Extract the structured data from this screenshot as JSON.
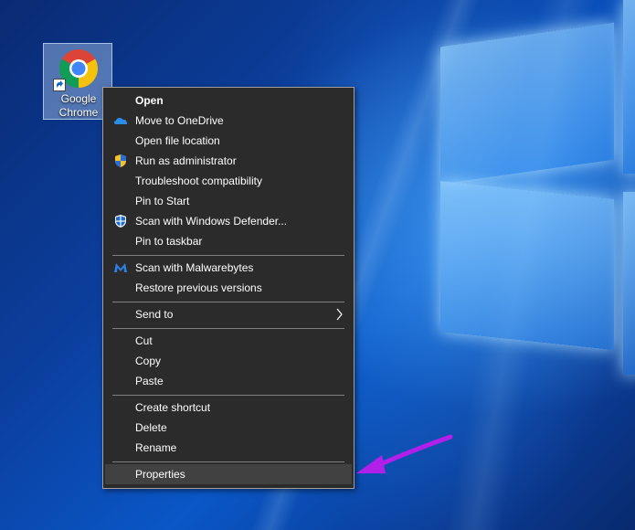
{
  "desktop": {
    "icon": {
      "name": "Google Chrome",
      "line1": "Google",
      "line2": "Chrome",
      "selected": true
    }
  },
  "context_menu": {
    "items": [
      {
        "label": "Open",
        "bold": true,
        "icon": null
      },
      {
        "label": "Move to OneDrive",
        "icon": "onedrive-cloud-icon"
      },
      {
        "label": "Open file location",
        "icon": null
      },
      {
        "label": "Run as administrator",
        "icon": "uac-shield-icon"
      },
      {
        "label": "Troubleshoot compatibility",
        "icon": null
      },
      {
        "label": "Pin to Start",
        "icon": null
      },
      {
        "label": "Scan with Windows Defender...",
        "icon": "defender-shield-icon"
      },
      {
        "label": "Pin to taskbar",
        "icon": null
      },
      {
        "label": "Scan with Malwarebytes",
        "icon": "malwarebytes-icon"
      },
      {
        "label": "Restore previous versions",
        "icon": null
      },
      {
        "label": "Send to",
        "icon": null,
        "submenu": true
      },
      {
        "label": "Cut",
        "icon": null
      },
      {
        "label": "Copy",
        "icon": null
      },
      {
        "label": "Paste",
        "icon": null
      },
      {
        "label": "Create shortcut",
        "icon": null
      },
      {
        "label": "Delete",
        "icon": null
      },
      {
        "label": "Rename",
        "icon": null
      },
      {
        "label": "Properties",
        "icon": null,
        "highlighted": true
      }
    ]
  },
  "annotation": {
    "arrow_color": "#b020e8",
    "points_to": "Properties"
  },
  "colors": {
    "menu_bg": "#2b2b2b",
    "menu_text": "#ffffff",
    "highlight": "#414141",
    "separator": "#808080"
  }
}
